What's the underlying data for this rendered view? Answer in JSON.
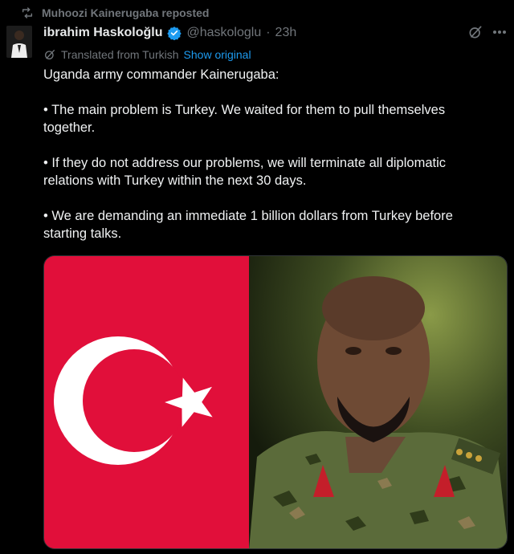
{
  "repost": {
    "label": "Muhoozi Kainerugaba reposted",
    "icon": "repost-icon"
  },
  "author": {
    "name": "ibrahim Haskoloğlu",
    "handle": "@haskologlu",
    "separator": "·",
    "time": "23h",
    "verified": true
  },
  "translation": {
    "label": "Translated from Turkish",
    "show_original": "Show original"
  },
  "tweet": {
    "paragraphs": [
      "Uganda army commander Kainerugaba:",
      "• The main problem is Turkey. We waited for them to pull themselves together.",
      "• If they do not address our problems, we will terminate all diplomatic relations with Turkey within the next 30 days.",
      "• We are demanding an immediate 1 billion dollars from Turkey before starting talks."
    ]
  },
  "colors": {
    "background": "#000000",
    "accent": "#1d9bf0",
    "muted": "#71767b",
    "flag_red": "#e10f3a"
  }
}
